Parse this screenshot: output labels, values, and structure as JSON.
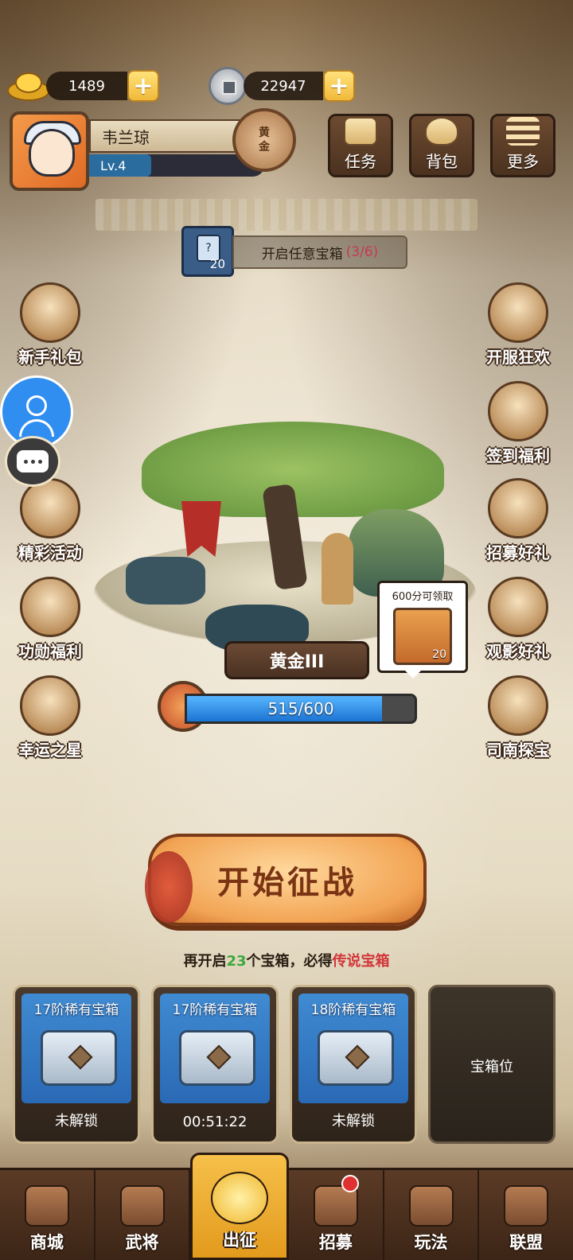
{
  "currency": {
    "gold": "1489",
    "silver": "22947"
  },
  "player": {
    "name": "韦兰琼",
    "level": "Lv.4",
    "rank_badge_top": "黄",
    "rank_badge_bottom": "金"
  },
  "top_buttons": [
    {
      "label": "任务",
      "icon": "scroll-icon"
    },
    {
      "label": "背包",
      "icon": "bag-icon"
    },
    {
      "label": "更多",
      "icon": "menu-icon"
    }
  ],
  "quest": {
    "card_count": "20",
    "card_symbol": "?",
    "text": "开启任意宝箱",
    "progress": "(3/6)"
  },
  "left_side": [
    {
      "label": "新手礼包"
    },
    {
      "label": "精彩活动"
    },
    {
      "label": "功勋福利"
    },
    {
      "label": "幸运之星"
    }
  ],
  "right_side": [
    {
      "label": "开服狂欢"
    },
    {
      "label": "签到福利"
    },
    {
      "label": "招募好礼"
    },
    {
      "label": "观影好礼"
    },
    {
      "label": "司南探宝"
    }
  ],
  "rank": {
    "name": "黄金III",
    "score_text": "515/600",
    "score": 515,
    "score_max": 600
  },
  "reward_bubble": {
    "text": "600分可领取",
    "count": "20"
  },
  "start_button": "开始征战",
  "chest_hint": {
    "pre": "再开启",
    "count": "23",
    "mid": "个宝箱，必得",
    "legend": "传说宝箱"
  },
  "chests": [
    {
      "title": "17阶稀有宝箱",
      "status": "未解锁"
    },
    {
      "title": "17阶稀有宝箱",
      "status": "00:51:22"
    },
    {
      "title": "18阶稀有宝箱",
      "status": "未解锁"
    },
    {
      "title": "",
      "status": "宝箱位"
    }
  ],
  "nav": [
    {
      "label": "商城"
    },
    {
      "label": "武将"
    },
    {
      "label": "出征"
    },
    {
      "label": "招募"
    },
    {
      "label": "玩法"
    },
    {
      "label": "联盟"
    }
  ],
  "colors": {
    "accent_gold": "#f0b93a",
    "progress_blue": "#1c74d2",
    "legend_red": "#d2363a",
    "count_green": "#3aa83a"
  }
}
